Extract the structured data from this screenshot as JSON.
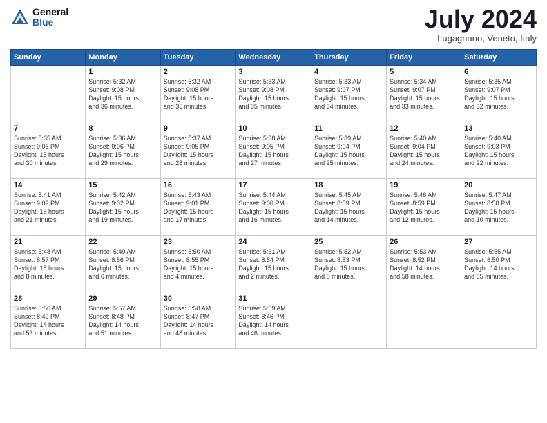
{
  "logo": {
    "general": "General",
    "blue": "Blue"
  },
  "title": "July 2024",
  "location": "Lugagnano, Veneto, Italy",
  "weekdays": [
    "Sunday",
    "Monday",
    "Tuesday",
    "Wednesday",
    "Thursday",
    "Friday",
    "Saturday"
  ],
  "weeks": [
    [
      {
        "day": "",
        "info": ""
      },
      {
        "day": "1",
        "info": "Sunrise: 5:32 AM\nSunset: 9:08 PM\nDaylight: 15 hours\nand 36 minutes."
      },
      {
        "day": "2",
        "info": "Sunrise: 5:32 AM\nSunset: 9:08 PM\nDaylight: 15 hours\nand 35 minutes."
      },
      {
        "day": "3",
        "info": "Sunrise: 5:33 AM\nSunset: 9:08 PM\nDaylight: 15 hours\nand 35 minutes."
      },
      {
        "day": "4",
        "info": "Sunrise: 5:33 AM\nSunset: 9:07 PM\nDaylight: 15 hours\nand 34 minutes."
      },
      {
        "day": "5",
        "info": "Sunrise: 5:34 AM\nSunset: 9:07 PM\nDaylight: 15 hours\nand 33 minutes."
      },
      {
        "day": "6",
        "info": "Sunrise: 5:35 AM\nSunset: 9:07 PM\nDaylight: 15 hours\nand 32 minutes."
      }
    ],
    [
      {
        "day": "7",
        "info": "Sunrise: 5:35 AM\nSunset: 9:06 PM\nDaylight: 15 hours\nand 30 minutes."
      },
      {
        "day": "8",
        "info": "Sunrise: 5:36 AM\nSunset: 9:06 PM\nDaylight: 15 hours\nand 29 minutes."
      },
      {
        "day": "9",
        "info": "Sunrise: 5:37 AM\nSunset: 9:05 PM\nDaylight: 15 hours\nand 28 minutes."
      },
      {
        "day": "10",
        "info": "Sunrise: 5:38 AM\nSunset: 9:05 PM\nDaylight: 15 hours\nand 27 minutes."
      },
      {
        "day": "11",
        "info": "Sunrise: 5:39 AM\nSunset: 9:04 PM\nDaylight: 15 hours\nand 25 minutes."
      },
      {
        "day": "12",
        "info": "Sunrise: 5:40 AM\nSunset: 9:04 PM\nDaylight: 15 hours\nand 24 minutes."
      },
      {
        "day": "13",
        "info": "Sunrise: 5:40 AM\nSunset: 9:03 PM\nDaylight: 15 hours\nand 22 minutes."
      }
    ],
    [
      {
        "day": "14",
        "info": "Sunrise: 5:41 AM\nSunset: 9:02 PM\nDaylight: 15 hours\nand 21 minutes."
      },
      {
        "day": "15",
        "info": "Sunrise: 5:42 AM\nSunset: 9:02 PM\nDaylight: 15 hours\nand 19 minutes."
      },
      {
        "day": "16",
        "info": "Sunrise: 5:43 AM\nSunset: 9:01 PM\nDaylight: 15 hours\nand 17 minutes."
      },
      {
        "day": "17",
        "info": "Sunrise: 5:44 AM\nSunset: 9:00 PM\nDaylight: 15 hours\nand 16 minutes."
      },
      {
        "day": "18",
        "info": "Sunrise: 5:45 AM\nSunset: 8:59 PM\nDaylight: 15 hours\nand 14 minutes."
      },
      {
        "day": "19",
        "info": "Sunrise: 5:46 AM\nSunset: 8:59 PM\nDaylight: 15 hours\nand 12 minutes."
      },
      {
        "day": "20",
        "info": "Sunrise: 5:47 AM\nSunset: 8:58 PM\nDaylight: 15 hours\nand 10 minutes."
      }
    ],
    [
      {
        "day": "21",
        "info": "Sunrise: 5:48 AM\nSunset: 8:57 PM\nDaylight: 15 hours\nand 8 minutes."
      },
      {
        "day": "22",
        "info": "Sunrise: 5:49 AM\nSunset: 8:56 PM\nDaylight: 15 hours\nand 6 minutes."
      },
      {
        "day": "23",
        "info": "Sunrise: 5:50 AM\nSunset: 8:55 PM\nDaylight: 15 hours\nand 4 minutes."
      },
      {
        "day": "24",
        "info": "Sunrise: 5:51 AM\nSunset: 8:54 PM\nDaylight: 15 hours\nand 2 minutes."
      },
      {
        "day": "25",
        "info": "Sunrise: 5:52 AM\nSunset: 8:53 PM\nDaylight: 15 hours\nand 0 minutes."
      },
      {
        "day": "26",
        "info": "Sunrise: 5:53 AM\nSunset: 8:52 PM\nDaylight: 14 hours\nand 58 minutes."
      },
      {
        "day": "27",
        "info": "Sunrise: 5:55 AM\nSunset: 8:50 PM\nDaylight: 14 hours\nand 55 minutes."
      }
    ],
    [
      {
        "day": "28",
        "info": "Sunrise: 5:56 AM\nSunset: 8:49 PM\nDaylight: 14 hours\nand 53 minutes."
      },
      {
        "day": "29",
        "info": "Sunrise: 5:57 AM\nSunset: 8:48 PM\nDaylight: 14 hours\nand 51 minutes."
      },
      {
        "day": "30",
        "info": "Sunrise: 5:58 AM\nSunset: 8:47 PM\nDaylight: 14 hours\nand 48 minutes."
      },
      {
        "day": "31",
        "info": "Sunrise: 5:59 AM\nSunset: 8:46 PM\nDaylight: 14 hours\nand 46 minutes."
      },
      {
        "day": "",
        "info": ""
      },
      {
        "day": "",
        "info": ""
      },
      {
        "day": "",
        "info": ""
      }
    ]
  ]
}
